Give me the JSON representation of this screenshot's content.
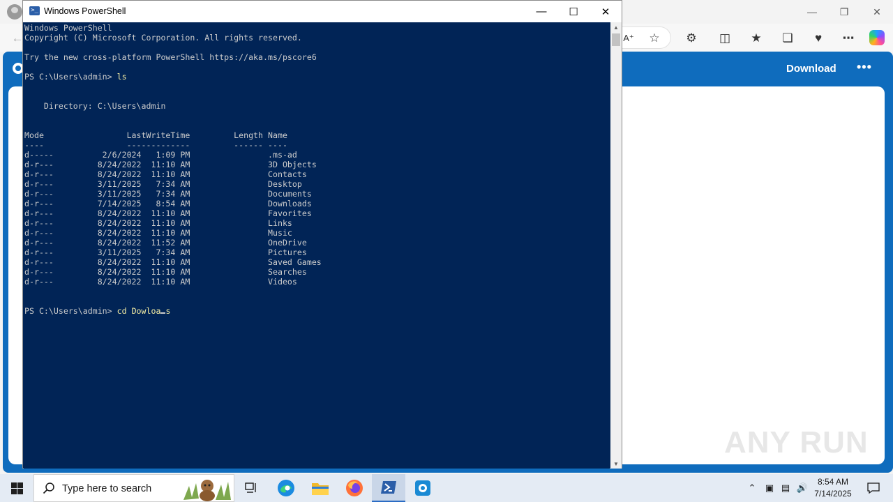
{
  "powershell": {
    "title": "Windows PowerShell",
    "lines": [
      "Windows PowerShell",
      "Copyright (C) Microsoft Corporation. All rights reserved.",
      "",
      "Try the new cross-platform PowerShell https://aka.ms/pscore6",
      "",
      "PS C:\\Users\\admin> ",
      "",
      "",
      "    Directory: C:\\Users\\admin",
      "",
      "",
      "Mode                 LastWriteTime         Length Name",
      "----                 -------------         ------ ----",
      "d-----          2/6/2024   1:09 PM                .ms-ad",
      "d-r---         8/24/2022  11:10 AM                3D Objects",
      "d-r---         8/24/2022  11:10 AM                Contacts",
      "d-r---         3/11/2025   7:34 AM                Desktop",
      "d-r---         3/11/2025   7:34 AM                Documents",
      "d-r---         7/14/2025   8:54 AM                Downloads",
      "d-r---         8/24/2022  11:10 AM                Favorites",
      "d-r---         8/24/2022  11:10 AM                Links",
      "d-r---         8/24/2022  11:10 AM                Music",
      "d-r---         8/24/2022  11:52 AM                OneDrive",
      "d-r---         3/11/2025   7:34 AM                Pictures",
      "d-r---         8/24/2022  11:10 AM                Saved Games",
      "d-r---         8/24/2022  11:10 AM                Searches",
      "d-r---         8/24/2022  11:10 AM                Videos",
      "",
      "",
      "PS C:\\Users\\admin> "
    ],
    "command_1": "ls",
    "command_2_before_cursor": "cd Dowloa",
    "command_2_after_cursor": "s",
    "colors": {
      "background": "#012456",
      "text": "#cccccc",
      "command": "#f9f1a5"
    }
  },
  "browser": {
    "page_header_button": "Download",
    "page_more_icon": "more-icon",
    "accent_color": "#0f6cbd"
  },
  "watermark": "ANY RUN",
  "taskbar": {
    "search_placeholder": "Type here to search",
    "apps": [
      "task-view-icon",
      "edge-icon",
      "file-explorer-icon",
      "firefox-icon",
      "powershell-icon",
      "app-icon"
    ],
    "active_app": "powershell-icon",
    "clock_time": "8:54 AM",
    "clock_date": "7/14/2025"
  }
}
